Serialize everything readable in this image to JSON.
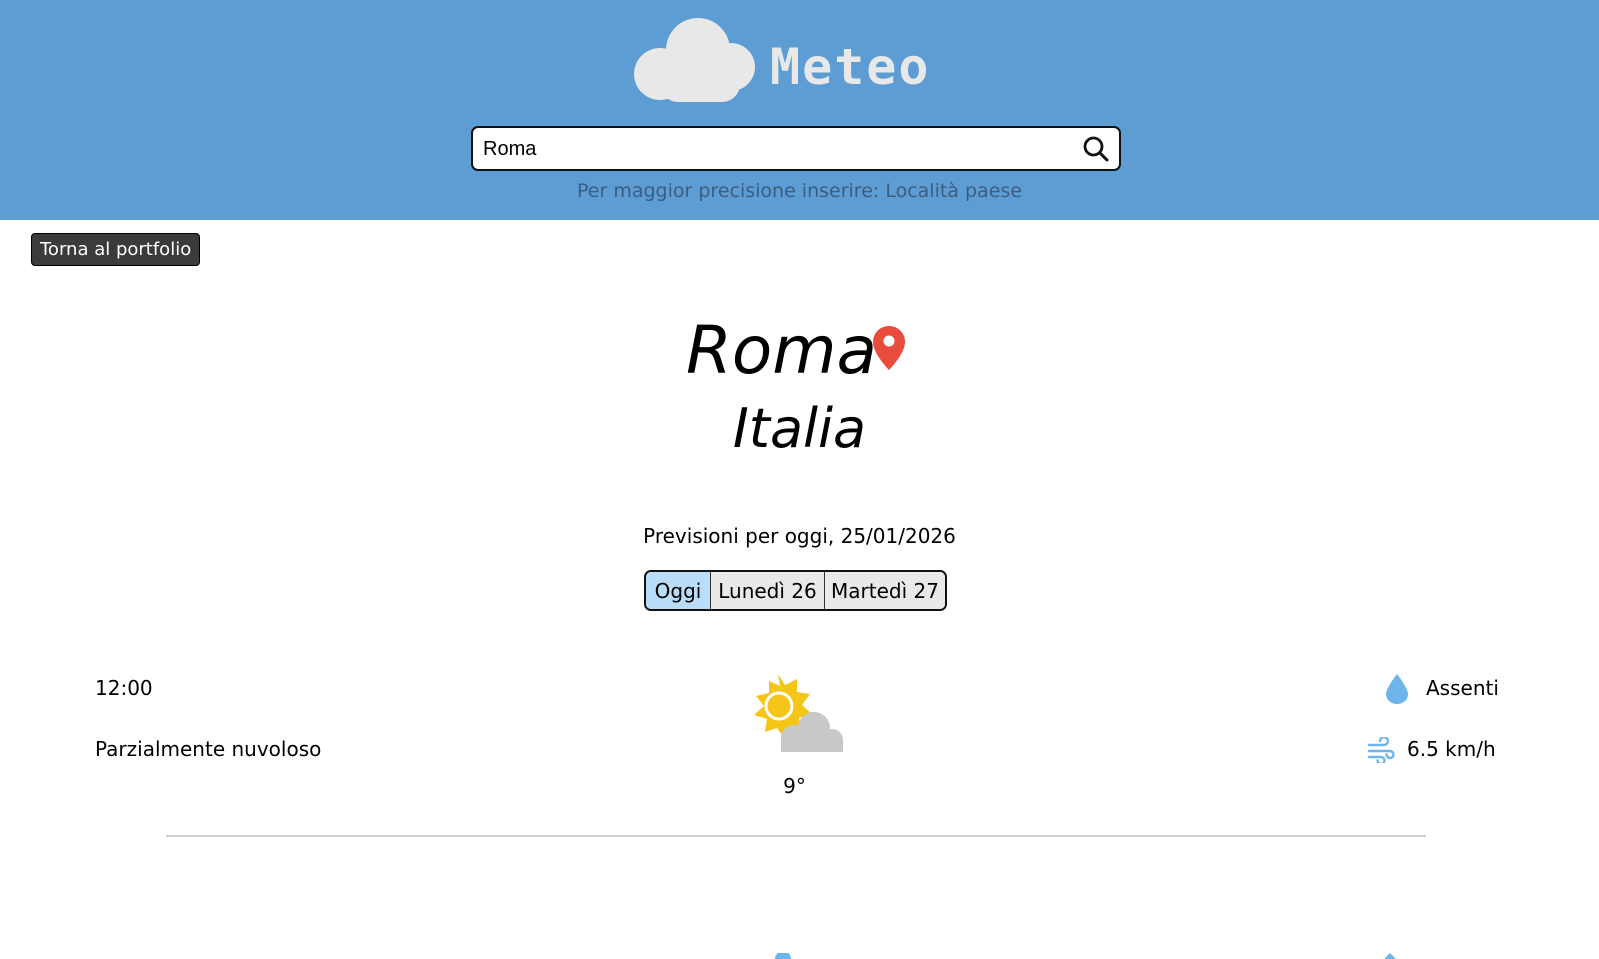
{
  "header": {
    "title": "Meteo",
    "search": {
      "value": "Roma",
      "placeholder": "",
      "icon": "search-icon"
    },
    "hint": "Per maggior precisione inserire: Località paese"
  },
  "back_button": {
    "label": "Torna al portfolio"
  },
  "location": {
    "city": "Roma",
    "country": "Italia",
    "pin_icon": "map-pin-icon"
  },
  "forecast": {
    "date_text": "Previsioni per oggi, 25/01/2026",
    "tabs": [
      {
        "label": "Oggi",
        "active": true
      },
      {
        "label": "Lunedì 26",
        "active": false
      },
      {
        "label": "Martedì 27",
        "active": false
      }
    ],
    "entries": [
      {
        "time": "12:00",
        "description": "Parzialmente nuvoloso",
        "icon": "partly-cloudy-icon",
        "temperature": "9°",
        "precipitation": "Assenti",
        "wind": "6.5 km/h"
      }
    ]
  },
  "colors": {
    "header_bg": "#5e9dd3",
    "title_color": "#e8e8e8",
    "hint_color": "#3a5e82",
    "active_tab": "#b9dcf9",
    "pin": "#e94b3c",
    "sun": "#f5c518",
    "cloud": "#c8c8c8",
    "drop": "#6db5ea"
  }
}
